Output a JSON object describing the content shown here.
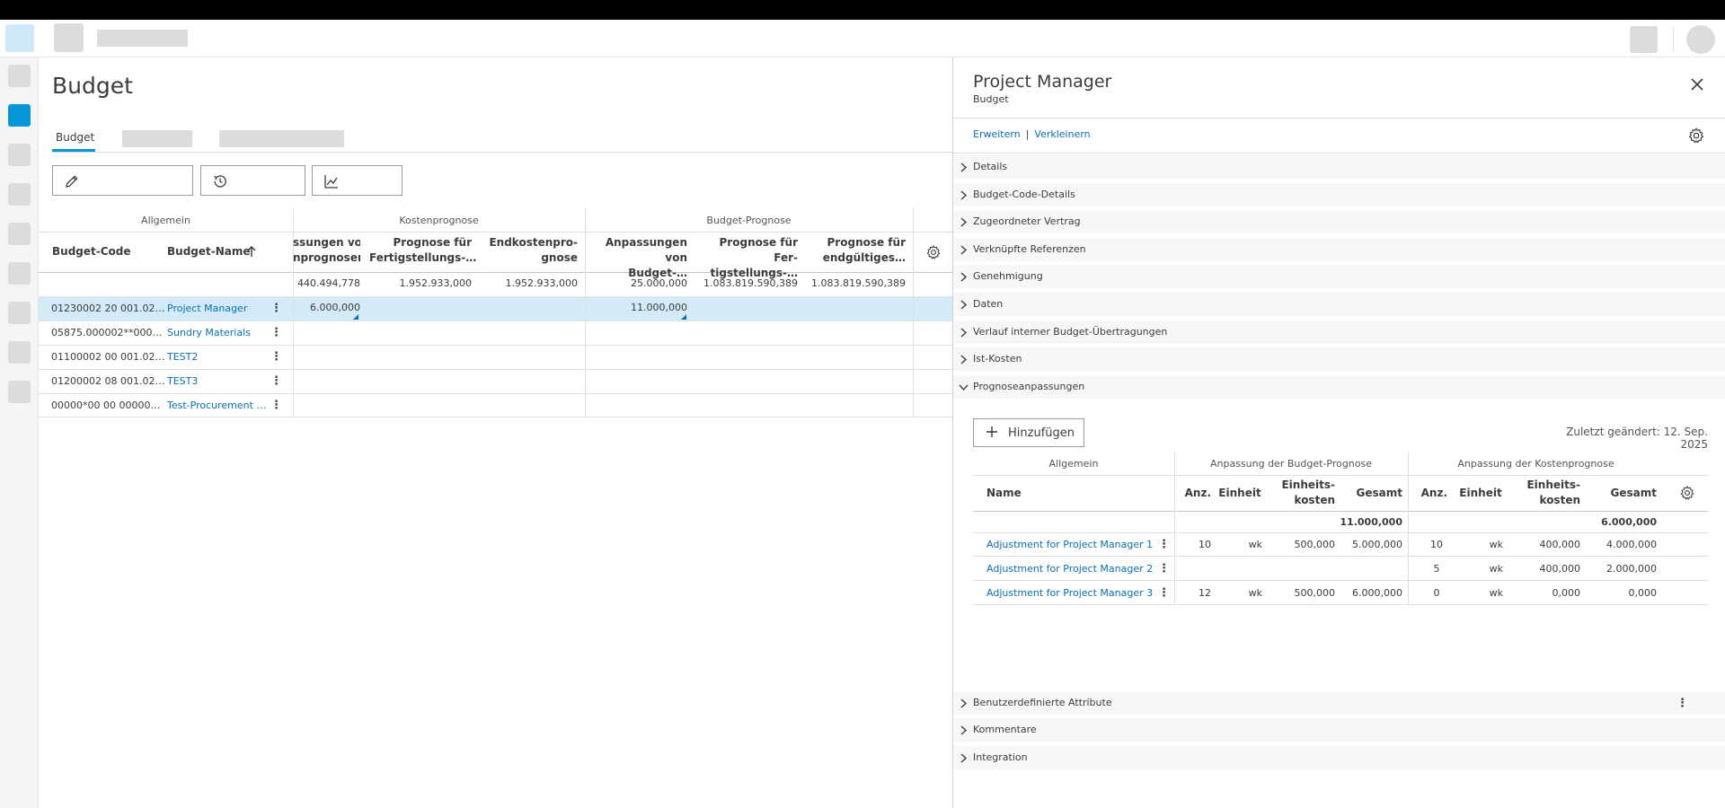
{
  "page": {
    "title": "Budget",
    "tabs": [
      {
        "label": "Budget"
      }
    ]
  },
  "grid": {
    "groups": {
      "general": "Allgemein",
      "cost_forecast": "Kostenprognose",
      "budget_forecast": "Budget-Prognose"
    },
    "columns": {
      "budget_code": "Budget-Code",
      "budget_name": "Budget-Name",
      "adj_forecasts_1": "ssungen von",
      "adj_forecasts_2": "nprognosen",
      "completion_forecast_1": "Prognose für",
      "completion_forecast_2": "Fertigstellungs-…",
      "final_cost_forecast_1": "Endkostenpro-",
      "final_cost_forecast_2": "gnose",
      "budget_adjustments_1": "Anpassungen von",
      "budget_adjustments_2": "Budget-…",
      "budget_completion_1": "Prognose für Fer-",
      "budget_completion_2": "tigstellungs-…",
      "budget_final_1": "Prognose für",
      "budget_final_2": "endgültiges…"
    },
    "totals": [
      "440.494,778",
      "1.952.933,000",
      "1.952.933,000",
      "25.000,000",
      "1.083.819.590,389",
      "1.083.819.590,389"
    ],
    "rows": [
      {
        "code": "01230002 20 001.02…",
        "name": "Project Manager",
        "adj_forecast": "6.000,000",
        "budget_adj": "11.000,000"
      },
      {
        "code": "05875.000002**000…",
        "name": "Sundry Materials",
        "adj_forecast": "",
        "budget_adj": ""
      },
      {
        "code": "01100002 00 001.02…",
        "name": "TEST2",
        "adj_forecast": "",
        "budget_adj": ""
      },
      {
        "code": "01200002 08 001.02…",
        "name": "TEST3",
        "adj_forecast": "",
        "budget_adj": ""
      },
      {
        "code": "00000*00 00 00000…",
        "name": "Test-Procurement …",
        "adj_forecast": "",
        "budget_adj": ""
      }
    ]
  },
  "panel": {
    "title": "Project Manager",
    "subtitle": "Budget",
    "expand_label": "Erweitern",
    "collapse_label": "Verkleinern",
    "sections": [
      {
        "label": "Details"
      },
      {
        "label": "Budget-Code-Details"
      },
      {
        "label": "Zugeordneter Vertrag"
      },
      {
        "label": "Verknüpfte Referenzen"
      },
      {
        "label": "Genehmigung"
      },
      {
        "label": "Daten"
      },
      {
        "label": "Verlauf interner Budget-Übertragungen"
      },
      {
        "label": "Ist-Kosten"
      },
      {
        "label": "Prognoseanpassungen"
      }
    ],
    "sections_after": [
      {
        "label": "Benutzerdefinierte Attribute"
      },
      {
        "label": "Kommentare"
      },
      {
        "label": "Integration"
      }
    ],
    "add_button": "Hinzufügen",
    "last_changed": "Zuletzt geändert: 12. Sep. 2025",
    "adjustments": {
      "groups": {
        "general": "Allgemein",
        "budget_forecast": "Anpassung der Budget-Prognose",
        "cost_forecast": "Anpassung der Kostenprognose"
      },
      "columns": {
        "name": "Name",
        "qty": "Anz.",
        "unit": "Einheit",
        "unit_cost_1": "Einheits-",
        "unit_cost_2": "kosten",
        "total": "Gesamt"
      },
      "totals": {
        "budget": "11.000,000",
        "cost": "6.000,000"
      },
      "rows": [
        {
          "name": "Adjustment for Project Manager 1",
          "b_qty": "10",
          "b_unit": "wk",
          "b_unit_cost": "500,000",
          "b_total": "5.000,000",
          "c_qty": "10",
          "c_unit": "wk",
          "c_unit_cost": "400,000",
          "c_total": "4.000,000"
        },
        {
          "name": "Adjustment for Project Manager 2",
          "b_qty": "",
          "b_unit": "",
          "b_unit_cost": "",
          "b_total": "",
          "c_qty": "5",
          "c_unit": "wk",
          "c_unit_cost": "400,000",
          "c_total": "2.000,000"
        },
        {
          "name": "Adjustment for Project Manager 3",
          "b_qty": "12",
          "b_unit": "wk",
          "b_unit_cost": "500,000",
          "b_total": "6.000,000",
          "c_qty": "0",
          "c_unit": "wk",
          "c_unit_cost": "0,000",
          "c_total": "0,000"
        }
      ]
    }
  },
  "colors": {
    "accent": "#0696d7",
    "link": "#0a6fb5",
    "selected_row": "#d3ebf7"
  }
}
